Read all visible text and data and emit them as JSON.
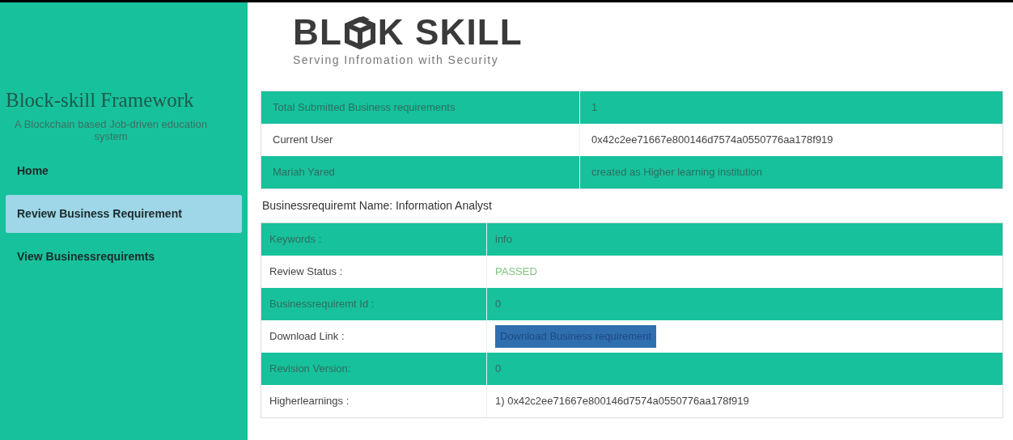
{
  "sidebar": {
    "title": "Block-skill Framework",
    "subtitle": "A Blockchain based Job-driven education system",
    "items": [
      {
        "label": "Home",
        "selected": false
      },
      {
        "label": "Review Business Requirement",
        "selected": true
      },
      {
        "label": "View Businessrequiremts",
        "selected": false
      }
    ]
  },
  "logo": {
    "left": "BL",
    "right": "K SKILL",
    "tagline": "Serving Infromation with Security"
  },
  "summary_table": {
    "rows": [
      {
        "label": "Total Submitted Business requirements",
        "value": "1"
      },
      {
        "label": "Current User",
        "value": "0x42c2ee71667e800146d7574a0550776aa178f919"
      },
      {
        "label": "Mariah Yared",
        "value": "created as Higher learning institution"
      }
    ]
  },
  "requirement_name": "Businessrequiremt Name: Information Analyst",
  "detail_table": {
    "rows": [
      {
        "kind": "text",
        "label": "Keywords :",
        "value": "info"
      },
      {
        "kind": "status",
        "label": "Review Status :",
        "value": "PASSED"
      },
      {
        "kind": "text",
        "label": "Businessrequiremt Id :",
        "value": "0"
      },
      {
        "kind": "button",
        "label": "Download Link :",
        "value": "Download Business requirement"
      },
      {
        "kind": "text",
        "label": "Revision Version:",
        "value": "0"
      },
      {
        "kind": "text",
        "label": "Higherlearnings :",
        "value": "1) 0x42c2ee71667e800146d7574a0550776aa178f919"
      }
    ]
  }
}
